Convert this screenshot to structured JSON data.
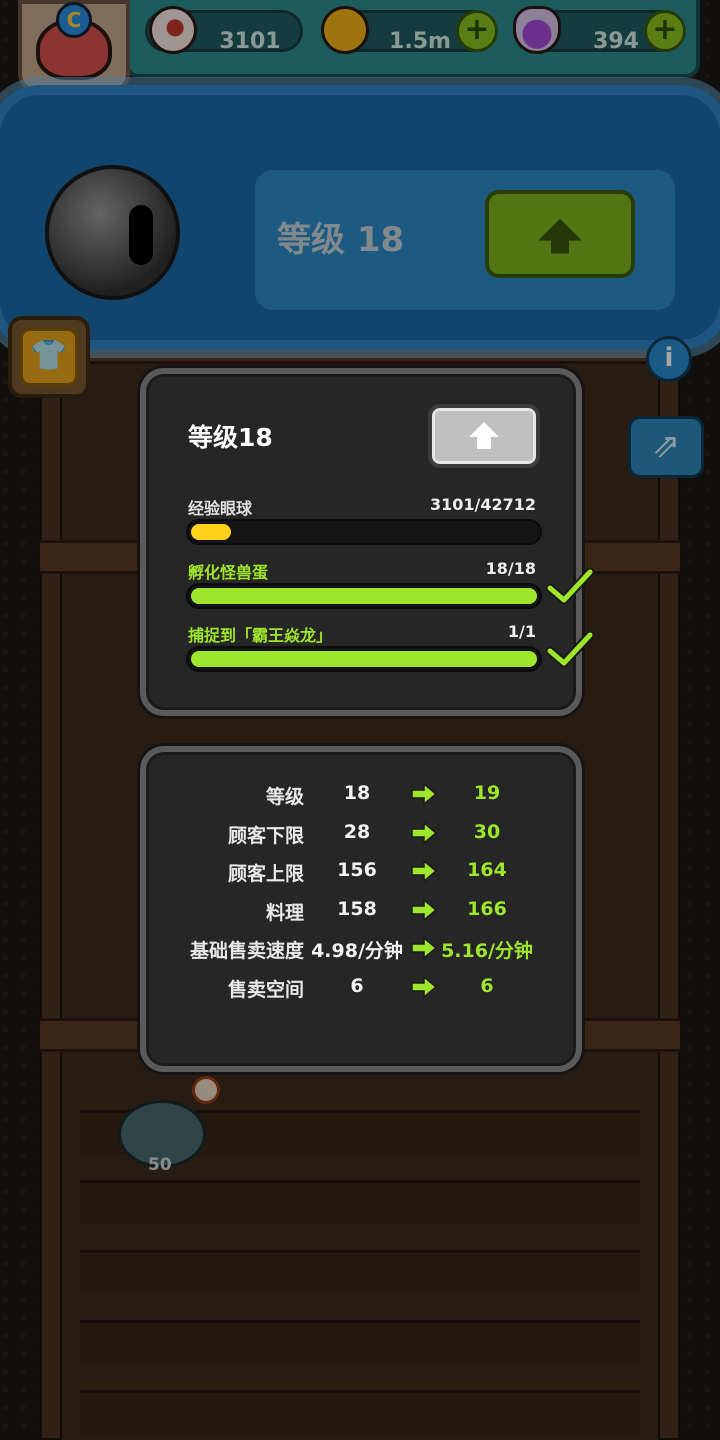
{
  "hud": {
    "eyeballs": "3101",
    "coins": "1.5m",
    "potions": "394",
    "avatar_badge": "C"
  },
  "banner": {
    "level_text": "等级 18"
  },
  "popup": {
    "title": "等级18",
    "exp_label": "经验眼球",
    "exp_value": "3101/42712",
    "exp_progress": 0.0726,
    "task1_label": "孵化怪兽蛋",
    "task1_value": "18/18",
    "task1_progress": 1.0,
    "task2_label": "捕捉到「霸王焱龙」",
    "task2_value": "1/1",
    "task2_progress": 1.0
  },
  "stats": [
    {
      "label": "等级",
      "current": "18",
      "next": "19"
    },
    {
      "label": "顾客下限",
      "current": "28",
      "next": "30"
    },
    {
      "label": "顾客上限",
      "current": "156",
      "next": "164"
    },
    {
      "label": "料理",
      "current": "158",
      "next": "166"
    },
    {
      "label": "基础售卖速度",
      "current": "4.98/分钟",
      "next": "5.16/分钟"
    },
    {
      "label": "售卖空间",
      "current": "6",
      "next": "6"
    }
  ],
  "shelf": {
    "dish_count": "50"
  },
  "colors": {
    "progress_green": "#9ee62b",
    "progress_yellow": "#ffd21a",
    "task_label_green": "#9ee62b",
    "panel_bg": "#262626"
  }
}
